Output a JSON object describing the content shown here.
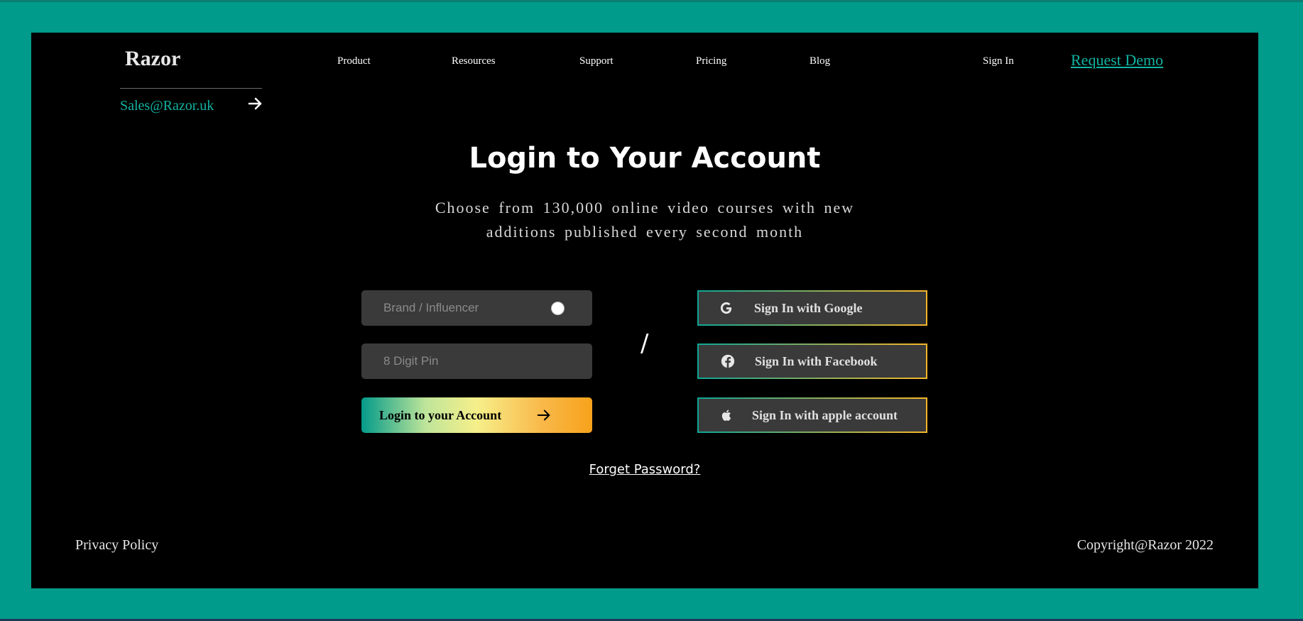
{
  "colors": {
    "background": "#009B8A",
    "frame": "#000000",
    "accent": "#12B3A1",
    "gradient_start": "#049B8A",
    "gradient_mid": "#F6EF8A",
    "gradient_end": "#F7A21B",
    "field_bg": "#3A3A3A"
  },
  "header": {
    "logo": "Razor",
    "email": "Sales@Razor.uk",
    "email_icon": "arrow-right-icon",
    "nav": [
      "Product",
      "Resources",
      "Support",
      "Pricing",
      "Blog"
    ],
    "sign_in": "Sign In",
    "request_demo": "Request Demo"
  },
  "hero": {
    "title": "Login to Your Account",
    "subtitle_line1": "Choose from 130,000 online video courses with new",
    "subtitle_line2": "additions published every second month"
  },
  "form": {
    "role_placeholder": "Brand / Influencer",
    "pin_placeholder": "8 Digit Pin",
    "login_button": "Login to your Account",
    "login_icon": "arrow-right-icon",
    "separator": "/"
  },
  "social": [
    {
      "label": "Sign In with Google",
      "icon": "google-icon"
    },
    {
      "label": "Sign In with Facebook",
      "icon": "facebook-icon"
    },
    {
      "label": "Sign In with apple account",
      "icon": "apple-icon"
    }
  ],
  "forget_password": "Forget Password?",
  "footer": {
    "privacy": "Privacy Policy",
    "copyright": "Copyright@Razor 2022"
  }
}
